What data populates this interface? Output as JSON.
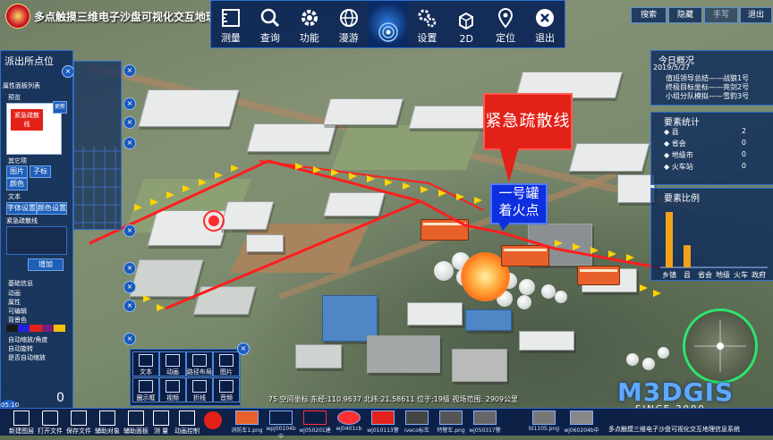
{
  "app": {
    "title": "多点触摸三维电子沙盘可视化交互地理",
    "top_right": {
      "search": "搜索",
      "hide": "隐藏",
      "hand": "手写",
      "exit": "退出"
    }
  },
  "toolbar": [
    {
      "label": "测量",
      "icon": "ruler-icon"
    },
    {
      "label": "查询",
      "icon": "search-icon"
    },
    {
      "label": "功能",
      "icon": "gear-icon"
    },
    {
      "label": "漫游",
      "icon": "globe-icon"
    },
    {
      "label": "",
      "icon": "radar-icon"
    },
    {
      "label": "设置",
      "icon": "settings-icon"
    },
    {
      "label": "2D",
      "icon": "cube-icon"
    },
    {
      "label": "定位",
      "icon": "location-pin-icon"
    },
    {
      "label": "退出",
      "icon": "close-icon"
    }
  ],
  "left_panel": {
    "title": "派出所点位",
    "tab": "属性面板列表",
    "section_preset": "预览",
    "preview_text": "紧急疏散线",
    "update_btn": "更新",
    "other_section": "其它项",
    "other_btns": [
      "图片",
      "子标",
      "颜色"
    ],
    "text_section": "文本",
    "text_btns": [
      "字体设置",
      "颜色设置"
    ],
    "text_value": "紧急疏散线",
    "add_btn": "增加",
    "basic_info": "基础信息",
    "animation": "动画",
    "attribute": "属性",
    "drawable": "可编辑",
    "bg_color": "背景色",
    "auto_label": "自动缩放/角度",
    "auto_opt1": "自动旋转",
    "auto_opt2": "是否自动缩放",
    "counter": "0",
    "time": "05:10"
  },
  "callouts": {
    "red": "紧急疏散线",
    "blue_line1": "一号罐",
    "blue_line2": "着火点"
  },
  "overview": {
    "title": "今日概况",
    "date": "2019/5/27",
    "rows": [
      "值班领导总结——战狼1号",
      "终极目标坐标——亮剑2号",
      "小组分队模拟——雪豹3号"
    ]
  },
  "stats": {
    "title": "要素统计",
    "rows": [
      {
        "label": "县",
        "value": "2"
      },
      {
        "label": "省会",
        "value": "0"
      },
      {
        "label": "地级市",
        "value": "0"
      },
      {
        "label": "火车站",
        "value": "0"
      }
    ]
  },
  "ratio": {
    "title": "要素比例",
    "categories": [
      "乡镇",
      "县",
      "省会",
      "地级",
      "火车",
      "政府"
    ],
    "values": [
      10,
      4,
      0,
      0,
      0,
      0
    ]
  },
  "status_bar": "75  空间坐标 东经:110.9637 北纬:21.58611 位于:19级 视场范围: 2909公里",
  "draw_tools": [
    {
      "label": "文本"
    },
    {
      "label": "动画"
    },
    {
      "label": "路径布局"
    },
    {
      "label": "图片"
    },
    {
      "label": "圈示框"
    },
    {
      "label": "视频"
    },
    {
      "label": "折线"
    },
    {
      "label": "音频"
    }
  ],
  "bottom_bar": {
    "items": [
      "新建图层",
      "打开文件",
      "保存文件",
      "辅助对象",
      "辅助面板",
      "测 量",
      "动画控制"
    ],
    "thumbs": [
      "消防车1.png",
      "wpj00104b中",
      "wj050201建",
      "wj0401cb",
      "wj010113警",
      "iveco标车",
      "特警车.png",
      "wj050317警",
      "bl1105.png",
      "wj060204b中"
    ]
  },
  "logo": {
    "name": "M3DGIS",
    "since": "SINCE 2000",
    "subtitle": "多点触摸三维电子沙盘可视化交互地理信息系统"
  }
}
